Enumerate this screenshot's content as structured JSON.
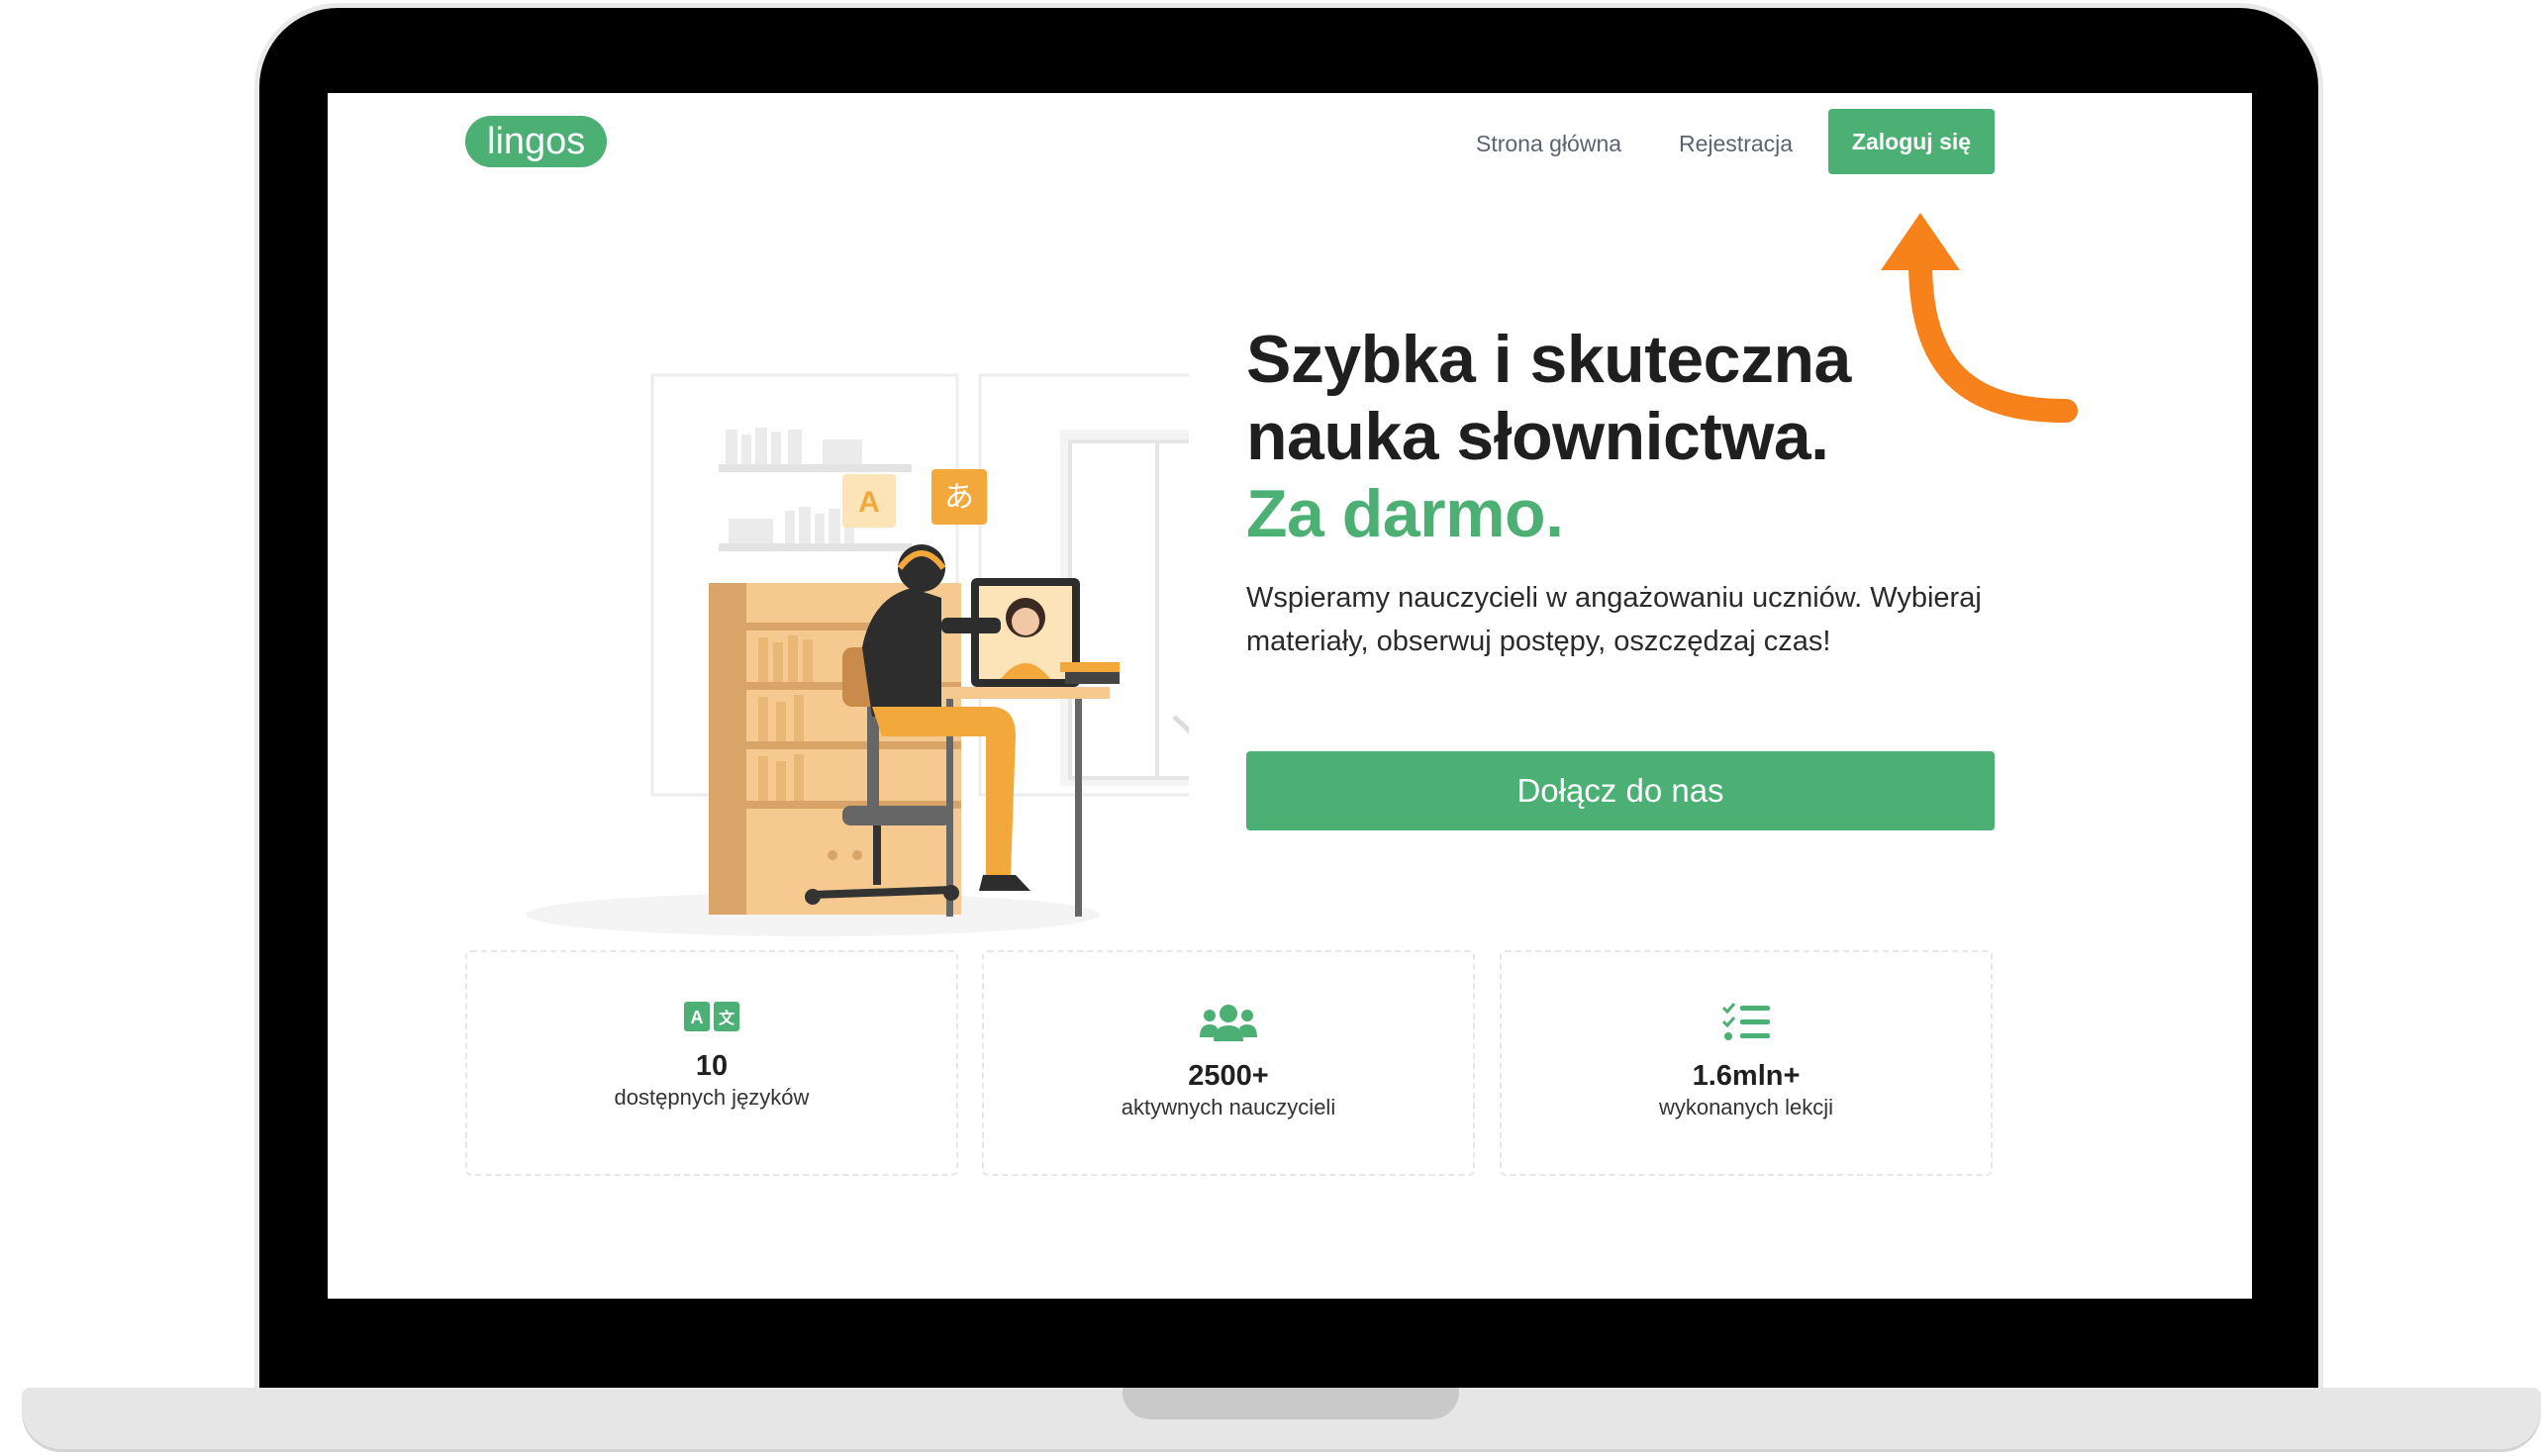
{
  "brand": {
    "logo_text": "lingos",
    "accent_color": "#4caf73",
    "arrow_color": "#f7821b"
  },
  "nav": {
    "home_label": "Strona główna",
    "register_label": "Rejestracja",
    "login_label": "Zaloguj się"
  },
  "hero": {
    "title_line1": "Szybka i skuteczna",
    "title_line2": "nauka słownictwa.",
    "title_accent": "Za darmo.",
    "description": "Wspieramy nauczycieli w angażowaniu uczniów. Wybieraj materiały, obserwuj postępy, oszczędzaj czas!",
    "cta_label": "Dołącz do nas",
    "illustration_bubbles": [
      "A",
      "あ"
    ]
  },
  "stats": [
    {
      "icon": "translate-icon",
      "value": "10",
      "label": "dostępnych języków"
    },
    {
      "icon": "users-icon",
      "value": "2500+",
      "label": "aktywnych nauczycieli"
    },
    {
      "icon": "checklist-icon",
      "value": "1.6mln+",
      "label": "wykonanych lekcji"
    }
  ]
}
